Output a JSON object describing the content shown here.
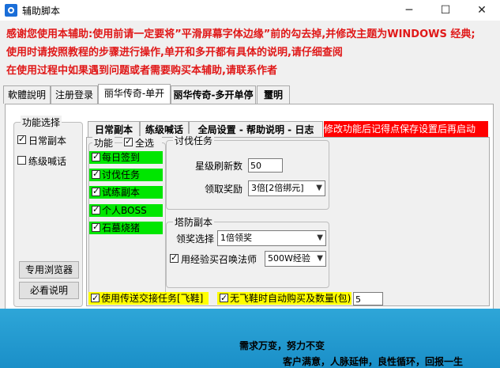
{
  "window": {
    "title": "辅助脚本",
    "minimize": "─",
    "maximize": "☐",
    "close": "✕"
  },
  "notices": [
    "感谢您使用本辅助:使用前请一定要将”平滑屏幕字体边缘”前的勾去掉,并修改主题为WINDOWS 经典;",
    "使用时请按照教程的步骤进行操作,单开和多开都有具体的说明,请仔细查阅",
    "在使用过程中如果遇到问题或者需要购买本辅助,请联系作者"
  ],
  "tabs": [
    {
      "label": "軟體說明"
    },
    {
      "label": "注册登录"
    },
    {
      "label": "丽华传奇-单开"
    },
    {
      "label": "丽华传奇-多开单停"
    },
    {
      "label": "璽明"
    }
  ],
  "left_group": {
    "title": "功能选择",
    "options": [
      {
        "label": "日常副本",
        "checked": true
      },
      {
        "label": "练级喊话",
        "checked": false
      }
    ],
    "buttons": {
      "browser": "专用浏览器",
      "manual": "必看说明"
    }
  },
  "subtabs": [
    {
      "label": "日常副本"
    },
    {
      "label": "练级喊话"
    },
    {
      "label": "全局设置 - 帮助说明 - 日志"
    }
  ],
  "warning_banner": "修改功能后记得点保存设置后再启动",
  "function_group": {
    "title": "功能",
    "select_all_label": "全选",
    "select_all_checked": true,
    "items": [
      {
        "label": "每日签到",
        "checked": true
      },
      {
        "label": "讨伐任务",
        "checked": true
      },
      {
        "label": "试练副本",
        "checked": true
      },
      {
        "label": "个人BOSS",
        "checked": true
      },
      {
        "label": "石墓烧猪",
        "checked": true
      }
    ]
  },
  "crusade": {
    "title": "讨伐任务",
    "refresh_label": "星级刷新数",
    "refresh_value": "50",
    "reward_label": "领取奖励",
    "reward_value": "3倍[2倍绑元]"
  },
  "tower": {
    "title": "塔防副本",
    "reward_label": "领奖选择",
    "reward_value": "1倍领奖",
    "exp_label": "用经验买召唤法师",
    "exp_checked": true,
    "exp_value": "500W经验"
  },
  "bottom_options": {
    "teleport_label": "使用传送交接任务[飞鞋]",
    "teleport_checked": true,
    "auto_buy_label": "无飞鞋时自动购买及数量(包)",
    "auto_buy_checked": true,
    "auto_buy_value": "5"
  },
  "footer": {
    "slogan1": "需求万变，努力不变",
    "slogan2": "客户满意，人脉延伸，良性循环，回报一生"
  },
  "colors": {
    "notice": "#e01818",
    "green": "#00e600",
    "yellow": "#ffff00",
    "banner": "#ff0000",
    "footer": "#1a8fc8"
  }
}
